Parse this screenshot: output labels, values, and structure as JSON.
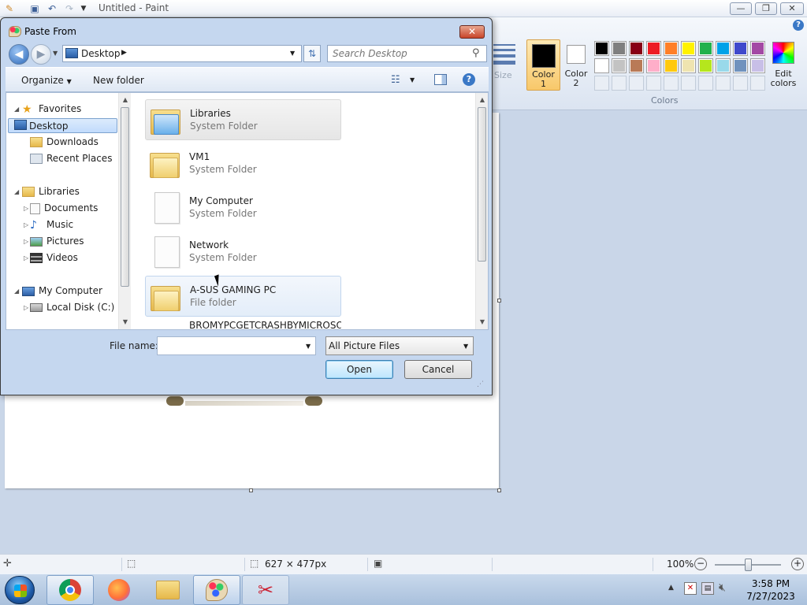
{
  "paint": {
    "title": "Untitled - Paint",
    "ribbon": {
      "size_label": "Size",
      "color1_label": "Color\n1",
      "color1_value": "#000000",
      "color2_label": "Color\n2",
      "color2_value": "#ffffff",
      "colors_group_label": "Colors",
      "edit_colors_label": "Edit\ncolors",
      "palette_row1": [
        "#000000",
        "#7f7f7f",
        "#880015",
        "#ed1c24",
        "#ff7f27",
        "#fff200",
        "#22b14c",
        "#00a2e8",
        "#3f48cc",
        "#a349a4"
      ],
      "palette_row2": [
        "#ffffff",
        "#c3c3c3",
        "#b97a57",
        "#ffaec9",
        "#ffc90e",
        "#efe4b0",
        "#b5e61d",
        "#99d9ea",
        "#7092be",
        "#c8bfe7"
      ]
    },
    "status": {
      "image_size": "627 × 477px",
      "zoom": "100%"
    }
  },
  "dialog": {
    "title": "Paste From",
    "close_label": "✕",
    "address": "Desktop",
    "search_placeholder": "Search Desktop",
    "toolbar": {
      "organize_label": "Organize",
      "new_folder_label": "New folder"
    },
    "nav": {
      "favorites": "Favorites",
      "desktop": "Desktop",
      "downloads": "Downloads",
      "recent_places": "Recent Places",
      "libraries": "Libraries",
      "documents": "Documents",
      "music": "Music",
      "pictures": "Pictures",
      "videos": "Videos",
      "my_computer": "My Computer",
      "local_disk": "Local Disk (C:)"
    },
    "items": [
      {
        "name": "Libraries",
        "type": "System Folder"
      },
      {
        "name": "VM1",
        "type": "System Folder"
      },
      {
        "name": "My Computer",
        "type": "System Folder"
      },
      {
        "name": "Network",
        "type": "System Folder"
      },
      {
        "name": "A-SUS GAMING PC",
        "type": "File folder"
      },
      {
        "name": "BROMYPCGETCRASHBYMICROSO",
        "type": ""
      }
    ],
    "file_name_label": "File name:",
    "file_name_value": "",
    "file_type_value": "All Picture Files",
    "open_label": "Open",
    "cancel_label": "Cancel"
  },
  "taskbar": {
    "time": "3:58 PM",
    "date": "7/27/2023"
  }
}
